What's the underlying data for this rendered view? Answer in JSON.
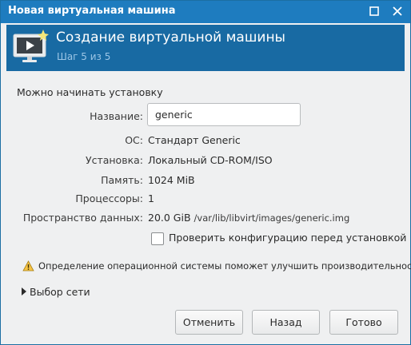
{
  "window": {
    "title": "Новая виртуальная машина",
    "icons": {
      "maximize": "maximize-icon",
      "close": "close-icon"
    }
  },
  "header": {
    "title": "Создание виртуальной машины",
    "step": "Шаг 5 из 5",
    "icon": "monitor-play-icon",
    "accent_color": "#186aa3"
  },
  "summary": {
    "heading": "Можно начинать установку",
    "name_label": "Название:",
    "name_value": "generic",
    "os_label": "ОС:",
    "os_value": "Стандарт Generic",
    "install_label": "Установка:",
    "install_value": "Локальный CD-ROM/ISO",
    "memory_label": "Память:",
    "memory_value": "1024 MiB",
    "cpu_label": "Процессоры:",
    "cpu_value": "1",
    "storage_label": "Пространство данных:",
    "storage_size": "20.0 GiB",
    "storage_path": "/var/lib/libvirt/images/generic.img",
    "customize_label": "Проверить конфигурацию перед установкой",
    "customize_checked": false
  },
  "warning": {
    "text": "Определение операционной системы поможет улучшить производительность",
    "icon": "warning-icon"
  },
  "network": {
    "label": "Выбор сети",
    "expanded": false
  },
  "buttons": {
    "cancel": "Отменить",
    "back": "Назад",
    "next": "Готово"
  }
}
